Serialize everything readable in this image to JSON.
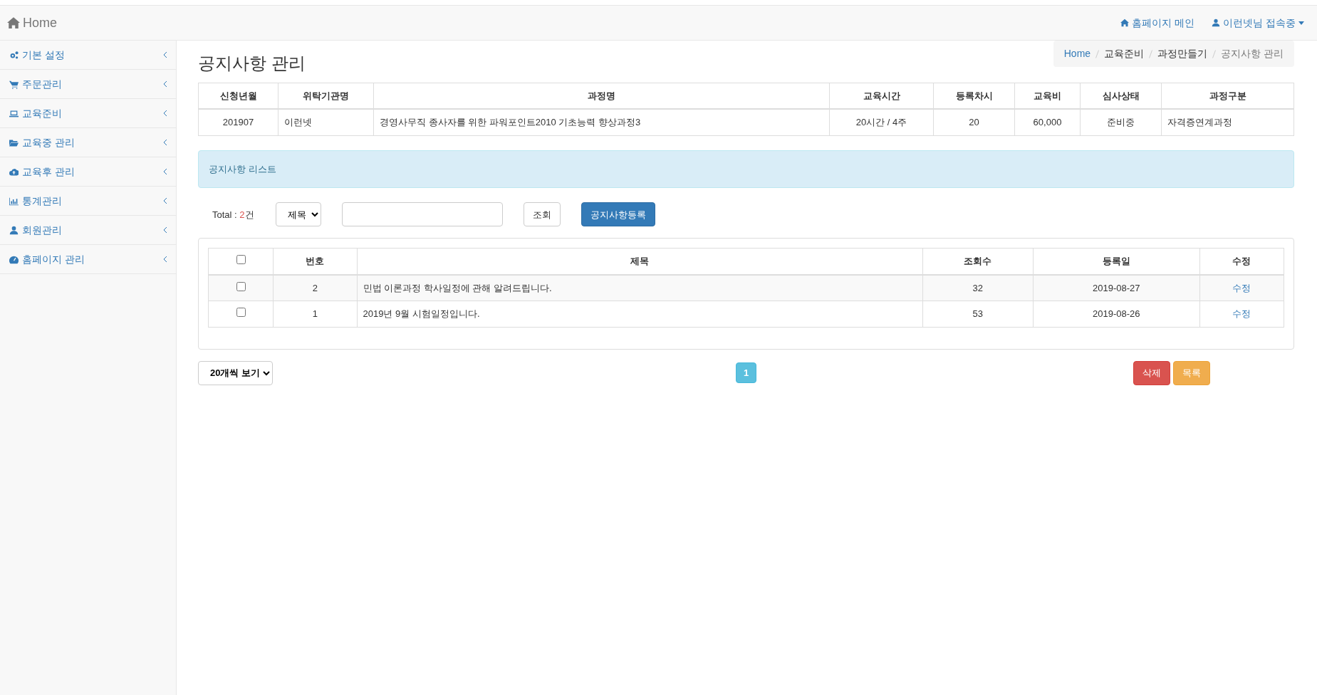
{
  "navbar": {
    "brand": "Home",
    "links": [
      {
        "kind": "home",
        "label": "홈페이지 메인"
      },
      {
        "kind": "user",
        "label": "이런넷님 접속중",
        "dropdown": true
      }
    ]
  },
  "sidebar": {
    "items": [
      {
        "label": "기본 설정"
      },
      {
        "label": "주문관리"
      },
      {
        "label": "교육준비"
      },
      {
        "label": "교육중 관리"
      },
      {
        "label": "교육후 관리"
      },
      {
        "label": "통계관리"
      },
      {
        "label": "회원관리"
      },
      {
        "label": "홈페이지 관리"
      }
    ]
  },
  "page_title": "공지사항 관리",
  "breadcrumb": [
    {
      "label": "Home",
      "link": true
    },
    {
      "label": "교육준비",
      "link": false
    },
    {
      "label": "과정만들기",
      "link": false
    },
    {
      "label": "공지사항 관리",
      "link": false
    }
  ],
  "course_table": {
    "columns": [
      "신청년월",
      "위탁기관명",
      "과정명",
      "교육시간",
      "등록차시",
      "교육비",
      "심사상태",
      "과정구분"
    ],
    "rows": [
      [
        "201907",
        "이런넷",
        "경영사무직 종사자를 위한 파워포인트2010 기초능력 향상과정3",
        "20시간 / 4주",
        "20",
        "60,000",
        "준비중",
        "자격증연계과정"
      ]
    ]
  },
  "list_heading": "공지사항 리스트",
  "filter": {
    "total_label": "Total : ",
    "total_count": "2",
    "total_unit": "건",
    "search_by": "제목",
    "search_button": "조회",
    "register_button": "공지사항등록"
  },
  "notice_table": {
    "select_all_checked": false,
    "columns": [
      "번호",
      "제목",
      "조회수",
      "등록일",
      "수정"
    ],
    "rows": [
      {
        "checked": false,
        "number": "2",
        "title": "민법 이론과정 학사일정에 관해 알려드립니다.",
        "views": "32",
        "date": "2019-08-27",
        "edit": "수정"
      },
      {
        "checked": false,
        "number": "1",
        "title": "2019년 9월 시험일정입니다.",
        "views": "53",
        "date": "2019-08-26",
        "edit": "수정"
      }
    ]
  },
  "page_size": "20개씩 보기",
  "pagination": [
    {
      "label": "1",
      "selected": true
    }
  ],
  "actions": [
    {
      "kind": "danger",
      "label": "삭제"
    },
    {
      "kind": "warning",
      "label": "목록"
    }
  ]
}
